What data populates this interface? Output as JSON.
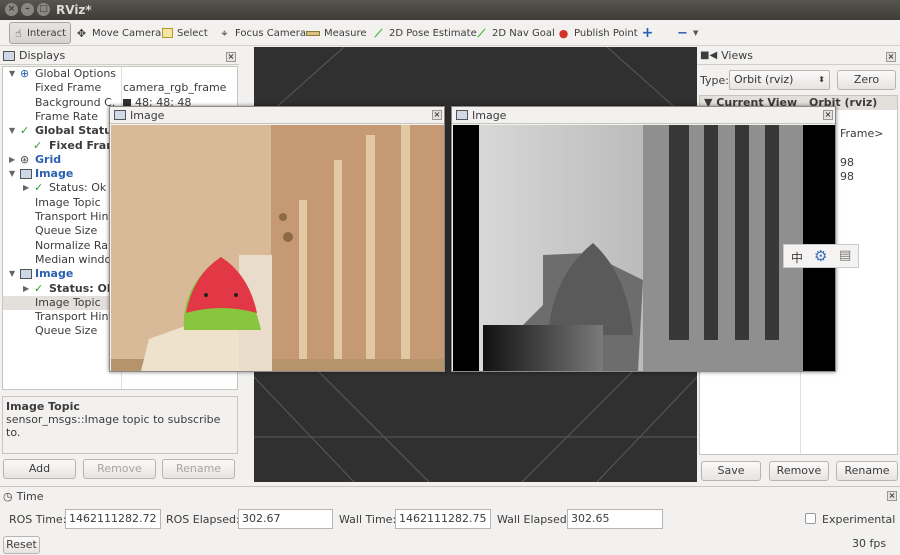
{
  "window": {
    "title": "RViz*"
  },
  "toolbar": {
    "tools": [
      {
        "label": "Interact",
        "icon": "hand-icon"
      },
      {
        "label": "Move Camera",
        "icon": "move-camera-icon"
      },
      {
        "label": "Select",
        "icon": "select-icon"
      },
      {
        "label": "Focus Camera",
        "icon": "focus-camera-icon"
      },
      {
        "label": "Measure",
        "icon": "ruler-icon"
      },
      {
        "label": "2D Pose Estimate",
        "icon": "green-arrow-icon"
      },
      {
        "label": "2D Nav Goal",
        "icon": "green-arrow-icon"
      },
      {
        "label": "Publish Point",
        "icon": "map-pin-icon"
      }
    ]
  },
  "displays": {
    "title": "Displays",
    "tree": [
      {
        "label": "Global Options",
        "value": "",
        "indent": 1
      },
      {
        "label": "Fixed Frame",
        "value": "camera_rgb_frame",
        "indent": 2
      },
      {
        "label": "Background C.",
        "value": "48; 48; 48",
        "indent": 2
      },
      {
        "label": "Frame Rate",
        "value": "",
        "indent": 2
      },
      {
        "label": "Global Status:",
        "value": "",
        "indent": 1
      },
      {
        "label": "Fixed Fram",
        "value": "",
        "indent": 2
      },
      {
        "label": "Grid",
        "value": "",
        "indent": 1
      },
      {
        "label": "Image",
        "value": "",
        "indent": 1
      },
      {
        "label": "Status: Ok",
        "value": "",
        "indent": 2
      },
      {
        "label": "Image Topic",
        "value": "",
        "indent": 2
      },
      {
        "label": "Transport Hint",
        "value": "",
        "indent": 2
      },
      {
        "label": "Queue Size",
        "value": "",
        "indent": 2
      },
      {
        "label": "Normalize Ra..",
        "value": "",
        "indent": 2
      },
      {
        "label": "Median windov",
        "value": "",
        "indent": 2
      },
      {
        "label": "Image",
        "value": "",
        "indent": 1
      },
      {
        "label": "Status: Ok",
        "value": "",
        "indent": 2
      },
      {
        "label": "Image Topic",
        "value": "",
        "indent": 2
      },
      {
        "label": "Transport Hint",
        "value": "",
        "indent": 2
      },
      {
        "label": "Queue Size",
        "value": "",
        "indent": 2
      }
    ],
    "description_title": "Image Topic",
    "description_text": "sensor_msgs::Image topic to subscribe to.",
    "add": "Add",
    "remove": "Remove",
    "rename": "Rename"
  },
  "image_windows": [
    {
      "title": "Image"
    },
    {
      "title": "Image"
    }
  ],
  "views": {
    "title": "Views",
    "type_label": "Type:",
    "type_value": "Orbit (rviz)",
    "zero": "Zero",
    "current_view_header": "Current View",
    "current_view_value": "Orbit (rviz)",
    "partial_lines": [
      "Frame>",
      "98",
      "98"
    ],
    "save": "Save",
    "remove": "Remove",
    "rename": "Rename"
  },
  "time": {
    "title": "Time",
    "ros_time_label": "ROS Time:",
    "ros_time": "1462111282.72",
    "ros_elapsed_label": "ROS Elapsed:",
    "ros_elapsed": "302.67",
    "wall_time_label": "Wall Time:",
    "wall_time": "1462111282.75",
    "wall_elapsed_label": "Wall Elapsed:",
    "wall_elapsed": "302.65",
    "experimental": "Experimental"
  },
  "status": {
    "reset": "Reset",
    "fps": "30 fps"
  },
  "colors": {
    "background": "#303030",
    "panel": "#f2f1f0",
    "blue_label": "#2a5fb0",
    "ok_check": "#2c9c2c"
  },
  "floating_icons": [
    "chinese-input-icon",
    "settings-gear-icon",
    "keyboard-icon"
  ],
  "floating_icon_glyphs": [
    "中",
    "⚙",
    "▤"
  ]
}
